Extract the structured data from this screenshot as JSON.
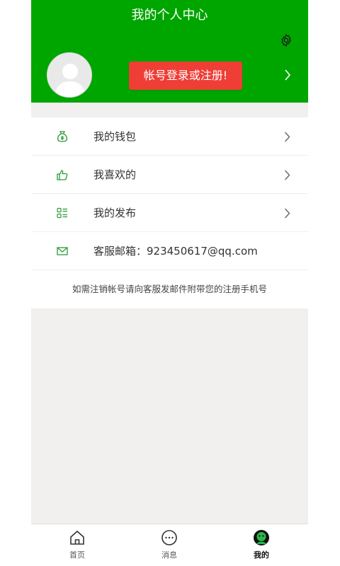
{
  "header": {
    "title": "我的个人中心",
    "login_button": "帐号登录或注册!",
    "settings_icon": "gear-icon",
    "avatar_icon": "default-avatar-icon"
  },
  "menu": {
    "items": [
      {
        "label": "我的钱包",
        "icon": "money-bag-icon"
      },
      {
        "label": "我喜欢的",
        "icon": "thumbs-up-icon"
      },
      {
        "label": "我的发布",
        "icon": "list-icon"
      },
      {
        "label": "客服邮箱：923450617@qq.com",
        "icon": "mail-icon"
      }
    ],
    "notice": "如需注销帐号请向客服发邮件附带您的注册手机号"
  },
  "tabbar": {
    "tabs": [
      {
        "label": "首页",
        "icon": "home-icon"
      },
      {
        "label": "消息",
        "icon": "chat-bubble-icon"
      },
      {
        "label": "我的",
        "icon": "profile-icon"
      }
    ],
    "active": "我的"
  },
  "colors": {
    "header_green": "#00a600",
    "login_red": "#ee3e35",
    "icon_green": "#2b9a35",
    "page_bg": "#f1f0ef"
  }
}
